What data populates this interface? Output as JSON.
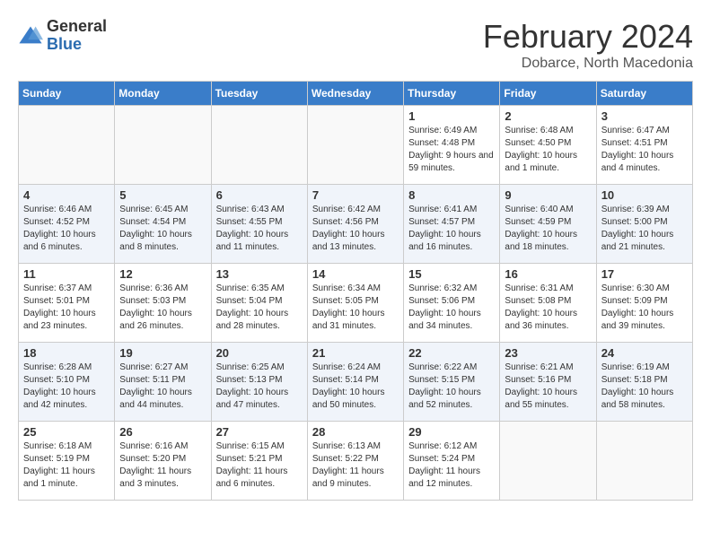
{
  "header": {
    "logo_general": "General",
    "logo_blue": "Blue",
    "month_title": "February 2024",
    "location": "Dobarce, North Macedonia"
  },
  "calendar": {
    "days_of_week": [
      "Sunday",
      "Monday",
      "Tuesday",
      "Wednesday",
      "Thursday",
      "Friday",
      "Saturday"
    ],
    "weeks": [
      [
        {
          "day": "",
          "info": ""
        },
        {
          "day": "",
          "info": ""
        },
        {
          "day": "",
          "info": ""
        },
        {
          "day": "",
          "info": ""
        },
        {
          "day": "1",
          "info": "Sunrise: 6:49 AM\nSunset: 4:48 PM\nDaylight: 9 hours and 59 minutes."
        },
        {
          "day": "2",
          "info": "Sunrise: 6:48 AM\nSunset: 4:50 PM\nDaylight: 10 hours and 1 minute."
        },
        {
          "day": "3",
          "info": "Sunrise: 6:47 AM\nSunset: 4:51 PM\nDaylight: 10 hours and 4 minutes."
        }
      ],
      [
        {
          "day": "4",
          "info": "Sunrise: 6:46 AM\nSunset: 4:52 PM\nDaylight: 10 hours and 6 minutes."
        },
        {
          "day": "5",
          "info": "Sunrise: 6:45 AM\nSunset: 4:54 PM\nDaylight: 10 hours and 8 minutes."
        },
        {
          "day": "6",
          "info": "Sunrise: 6:43 AM\nSunset: 4:55 PM\nDaylight: 10 hours and 11 minutes."
        },
        {
          "day": "7",
          "info": "Sunrise: 6:42 AM\nSunset: 4:56 PM\nDaylight: 10 hours and 13 minutes."
        },
        {
          "day": "8",
          "info": "Sunrise: 6:41 AM\nSunset: 4:57 PM\nDaylight: 10 hours and 16 minutes."
        },
        {
          "day": "9",
          "info": "Sunrise: 6:40 AM\nSunset: 4:59 PM\nDaylight: 10 hours and 18 minutes."
        },
        {
          "day": "10",
          "info": "Sunrise: 6:39 AM\nSunset: 5:00 PM\nDaylight: 10 hours and 21 minutes."
        }
      ],
      [
        {
          "day": "11",
          "info": "Sunrise: 6:37 AM\nSunset: 5:01 PM\nDaylight: 10 hours and 23 minutes."
        },
        {
          "day": "12",
          "info": "Sunrise: 6:36 AM\nSunset: 5:03 PM\nDaylight: 10 hours and 26 minutes."
        },
        {
          "day": "13",
          "info": "Sunrise: 6:35 AM\nSunset: 5:04 PM\nDaylight: 10 hours and 28 minutes."
        },
        {
          "day": "14",
          "info": "Sunrise: 6:34 AM\nSunset: 5:05 PM\nDaylight: 10 hours and 31 minutes."
        },
        {
          "day": "15",
          "info": "Sunrise: 6:32 AM\nSunset: 5:06 PM\nDaylight: 10 hours and 34 minutes."
        },
        {
          "day": "16",
          "info": "Sunrise: 6:31 AM\nSunset: 5:08 PM\nDaylight: 10 hours and 36 minutes."
        },
        {
          "day": "17",
          "info": "Sunrise: 6:30 AM\nSunset: 5:09 PM\nDaylight: 10 hours and 39 minutes."
        }
      ],
      [
        {
          "day": "18",
          "info": "Sunrise: 6:28 AM\nSunset: 5:10 PM\nDaylight: 10 hours and 42 minutes."
        },
        {
          "day": "19",
          "info": "Sunrise: 6:27 AM\nSunset: 5:11 PM\nDaylight: 10 hours and 44 minutes."
        },
        {
          "day": "20",
          "info": "Sunrise: 6:25 AM\nSunset: 5:13 PM\nDaylight: 10 hours and 47 minutes."
        },
        {
          "day": "21",
          "info": "Sunrise: 6:24 AM\nSunset: 5:14 PM\nDaylight: 10 hours and 50 minutes."
        },
        {
          "day": "22",
          "info": "Sunrise: 6:22 AM\nSunset: 5:15 PM\nDaylight: 10 hours and 52 minutes."
        },
        {
          "day": "23",
          "info": "Sunrise: 6:21 AM\nSunset: 5:16 PM\nDaylight: 10 hours and 55 minutes."
        },
        {
          "day": "24",
          "info": "Sunrise: 6:19 AM\nSunset: 5:18 PM\nDaylight: 10 hours and 58 minutes."
        }
      ],
      [
        {
          "day": "25",
          "info": "Sunrise: 6:18 AM\nSunset: 5:19 PM\nDaylight: 11 hours and 1 minute."
        },
        {
          "day": "26",
          "info": "Sunrise: 6:16 AM\nSunset: 5:20 PM\nDaylight: 11 hours and 3 minutes."
        },
        {
          "day": "27",
          "info": "Sunrise: 6:15 AM\nSunset: 5:21 PM\nDaylight: 11 hours and 6 minutes."
        },
        {
          "day": "28",
          "info": "Sunrise: 6:13 AM\nSunset: 5:22 PM\nDaylight: 11 hours and 9 minutes."
        },
        {
          "day": "29",
          "info": "Sunrise: 6:12 AM\nSunset: 5:24 PM\nDaylight: 11 hours and 12 minutes."
        },
        {
          "day": "",
          "info": ""
        },
        {
          "day": "",
          "info": ""
        }
      ]
    ]
  }
}
